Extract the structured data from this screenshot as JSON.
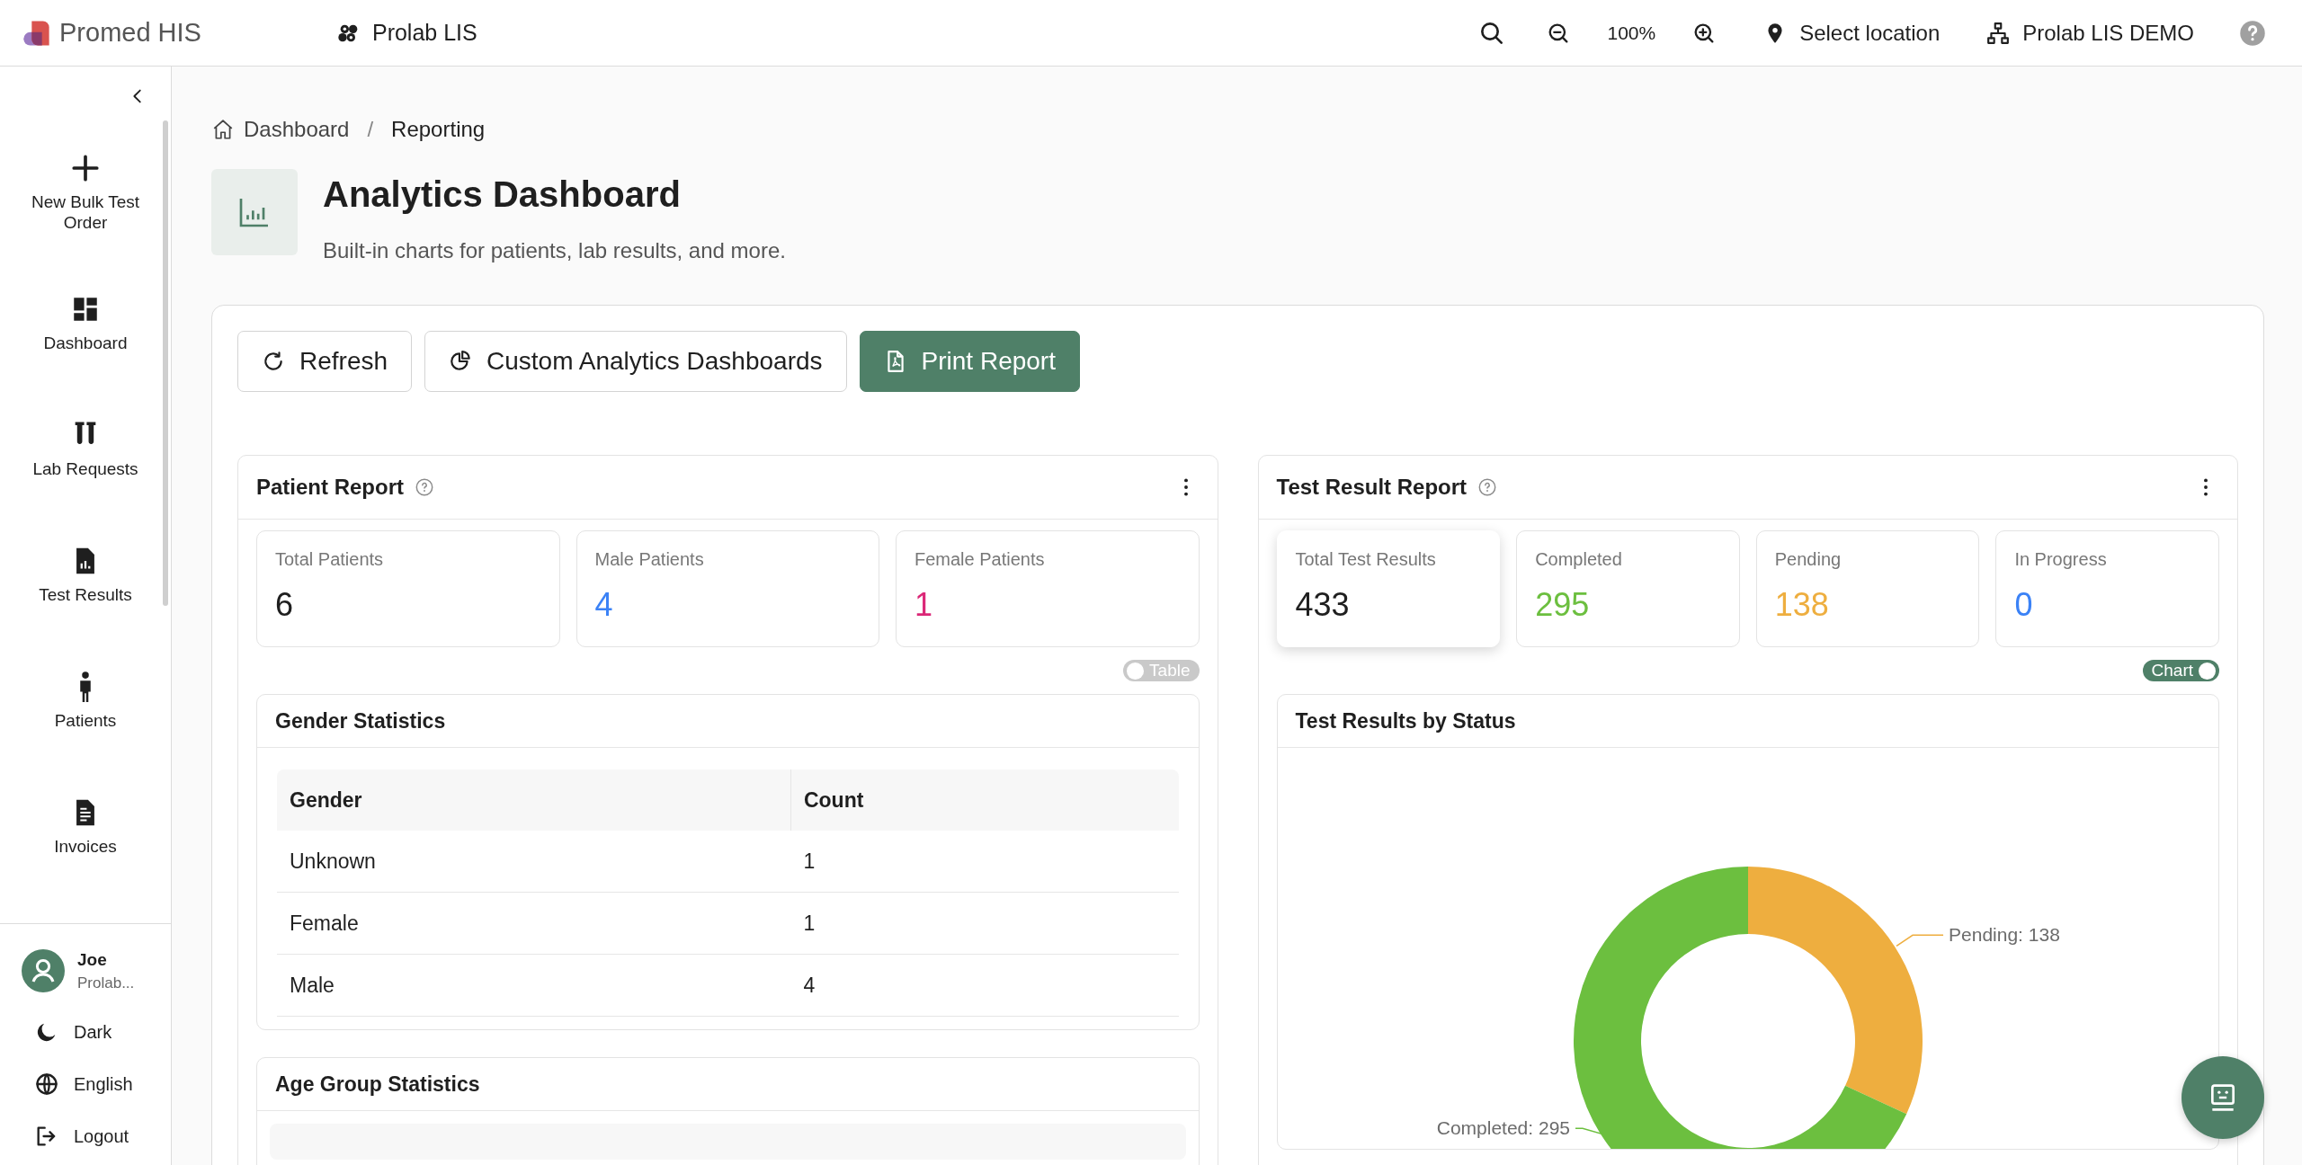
{
  "top_bar": {
    "brand": "Promed HIS",
    "app": "Prolab LIS",
    "zoom": "100%",
    "location": "Select location",
    "organization": "Prolab LIS DEMO"
  },
  "sidebar": {
    "items": [
      {
        "label": "New Bulk Test Order"
      },
      {
        "label": "Dashboard"
      },
      {
        "label": "Lab Requests"
      },
      {
        "label": "Test Results"
      },
      {
        "label": "Patients"
      },
      {
        "label": "Invoices"
      }
    ],
    "user": {
      "name": "Joe",
      "organization": "Prolab..."
    },
    "bottom_items": [
      {
        "label": "Dark"
      },
      {
        "label": "English"
      },
      {
        "label": "Logout"
      }
    ]
  },
  "breadcrumb": {
    "items": [
      {
        "label": "Dashboard"
      },
      {
        "label": "Reporting"
      }
    ],
    "separator": "/"
  },
  "header": {
    "title": "Analytics Dashboard",
    "subtitle": "Built-in charts for patients, lab results, and more."
  },
  "actions": [
    {
      "label": "Refresh",
      "kind": "outline"
    },
    {
      "label": "Custom Analytics Dashboards",
      "kind": "outline"
    },
    {
      "label": "Print Report",
      "kind": "primary"
    }
  ],
  "patient_report": {
    "title": "Patient Report",
    "stats": [
      {
        "label": "Total Patients",
        "value": "6",
        "color": "#1f1f1f",
        "selected": false
      },
      {
        "label": "Male Patients",
        "value": "4",
        "color": "#3b82f6",
        "selected": false
      },
      {
        "label": "Female Patients",
        "value": "1",
        "color": "#db2777",
        "selected": false
      }
    ],
    "view_toggle": {
      "label": "Table",
      "on": false
    },
    "sections": [
      {
        "title": "Gender Statistics",
        "table": {
          "columns": [
            "Gender",
            "Count"
          ],
          "rows": [
            [
              "Unknown",
              "1"
            ],
            [
              "Female",
              "1"
            ],
            [
              "Male",
              "4"
            ]
          ]
        }
      },
      {
        "title": "Age Group Statistics"
      }
    ]
  },
  "test_result_report": {
    "title": "Test Result Report",
    "stats": [
      {
        "label": "Total Test Results",
        "value": "433",
        "color": "#1f1f1f",
        "selected": true
      },
      {
        "label": "Completed",
        "value": "295",
        "color": "#6cbf3f",
        "selected": false
      },
      {
        "label": "Pending",
        "value": "138",
        "color": "#eeae3f",
        "selected": false
      },
      {
        "label": "In Progress",
        "value": "0",
        "color": "#3b82f6",
        "selected": false
      }
    ],
    "view_toggle": {
      "label": "Chart",
      "on": true
    },
    "chart_card": {
      "title": "Test Results by Status",
      "chart_data": {
        "type": "donut",
        "values": [
          295,
          138
        ],
        "colors": [
          "#6cbf3f",
          "#eeae3f"
        ],
        "value_labels": [
          "Completed: 295",
          "Pending: 138"
        ]
      }
    }
  }
}
